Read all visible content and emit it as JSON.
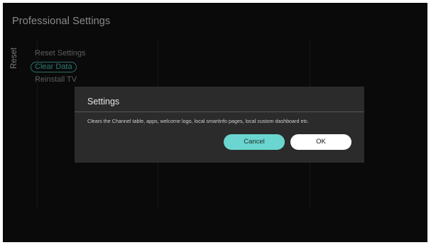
{
  "header": {
    "title": "Professional Settings"
  },
  "sidebar": {
    "section_label": "Reset"
  },
  "menu": {
    "items": [
      {
        "label": "Reset Settings",
        "selected": false
      },
      {
        "label": "Clear Data",
        "selected": true
      },
      {
        "label": "Reinstall TV",
        "selected": false
      }
    ]
  },
  "dialog": {
    "title": "Settings",
    "message": "Clears the Channel table, apps, welcome logo, local smartinfo pages, local custom dashboard etc.",
    "cancel_label": "Cancel",
    "ok_label": "OK"
  },
  "colors": {
    "background": "#0a0a0a",
    "dialog": "#2b2b2b",
    "accent": "#6ad6cf",
    "selected_text": "#2b7a73"
  }
}
